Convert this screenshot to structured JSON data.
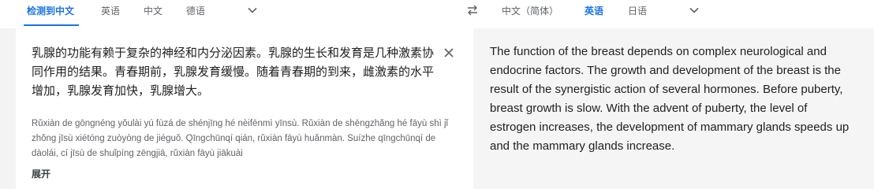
{
  "source_lang_bar": {
    "detected": "检测到中文",
    "tabs": [
      "英语",
      "中文",
      "德语"
    ]
  },
  "target_lang_bar": {
    "tabs": [
      "中文（简体）",
      "英语",
      "日语"
    ]
  },
  "source": {
    "text": "乳腺的功能有赖于复杂的神经和内分泌因素。乳腺的生长和发育是几种激素协同作用的结果。青春期前，乳腺发育缓慢。随着青春期的到来，雌激素的水平增加，乳腺发育加快，乳腺增大。",
    "romanization": "Rǔxiàn de gōngnéng yǒulài yú fùzá de shénjīng hé nèifēnmì yīnsù. Rǔxiàn de shēngzhǎng hé fāyù shì jǐ zhǒng jīsù xiétóng zuòyòng de jiéguǒ. Qīngchūnqí qián, rǔxiàn fāyù huǎnmàn. Suízhe qīngchūnqí de dàolái, cí jīsù de shuǐpíng zēngjiā, rǔxiàn fāyù jiākuài",
    "expand_label": "展开"
  },
  "target": {
    "lines": [
      "The function of the breast depends on complex neurological and",
      "endocrine factors. The growth and development of the breast is the",
      "result of the synergistic action of several hormones. Before puberty,",
      "breast growth is slow. With the advent of puberty, the level of",
      "estrogen increases, the development of mammary glands speeds up",
      "and the mammary glands increase."
    ]
  },
  "colors": {
    "accent": "#1a73e8",
    "target_bg": "#f5f5f5"
  },
  "icons": [
    "chevron-down-icon",
    "swap-languages-icon",
    "close-icon"
  ]
}
